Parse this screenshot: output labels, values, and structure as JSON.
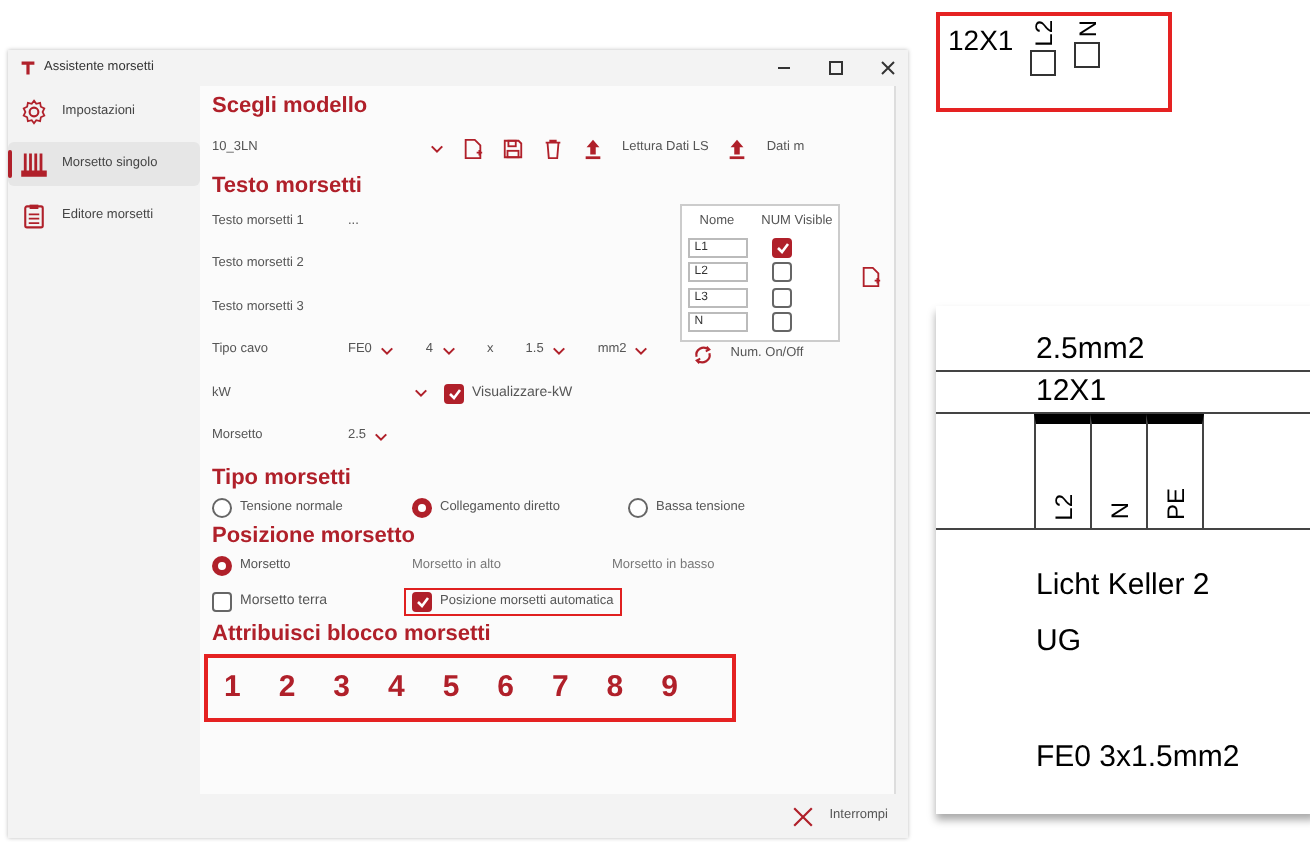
{
  "window": {
    "title": "Assistente morsetti"
  },
  "sidebar": {
    "items": [
      {
        "label": "Impostazioni",
        "selected": false,
        "kind": "gear"
      },
      {
        "label": "Morsetto singolo",
        "selected": true,
        "kind": "terminal"
      },
      {
        "label": "Editore morsetti",
        "selected": false,
        "kind": "clipboard"
      }
    ]
  },
  "model": {
    "heading": "Scegli modello",
    "value": "10_3LN",
    "actions": [
      {
        "kind": "new"
      },
      {
        "kind": "save"
      },
      {
        "kind": "delete"
      },
      {
        "kind": "upload",
        "label": "Lettura Dati LS"
      },
      {
        "kind": "upload",
        "label": "Dati m"
      }
    ]
  },
  "text_section": {
    "heading": "Testo morsetti",
    "fields": [
      {
        "label": "Testo morsetti 1",
        "value": "..."
      },
      {
        "label": "Testo morsetti 2"
      },
      {
        "label": "Testo morsetti 3"
      }
    ],
    "cable": {
      "label": "Tipo cavo",
      "selects": [
        "FE0",
        "4",
        "1.5",
        "mm2"
      ],
      "separator": "x"
    },
    "kw": {
      "label": "kW",
      "checkbox": {
        "label": "Visualizzare-kW",
        "checked": true
      }
    },
    "terminal": {
      "label": "Morsetto",
      "value": "2.5"
    },
    "names_table": {
      "columns": [
        "Nome",
        "NUM Visible"
      ],
      "rows": [
        {
          "name": "L1",
          "checked": true
        },
        {
          "name": "L2",
          "checked": false
        },
        {
          "name": "L3",
          "checked": false
        },
        {
          "name": "N",
          "checked": false
        }
      ]
    },
    "num_toggle": "Num. On/Off"
  },
  "type_section": {
    "heading": "Tipo morsetti",
    "options": [
      {
        "label": "Tensione normale",
        "selected": false
      },
      {
        "label": "Collegamento diretto",
        "selected": true
      },
      {
        "label": "Bassa tensione",
        "selected": false
      }
    ]
  },
  "position_section": {
    "heading": "Posizione morsetto",
    "options": [
      {
        "label": "Morsetto",
        "selected": true,
        "disabled": false
      },
      {
        "label": "Morsetto in alto",
        "disabled": true
      },
      {
        "label": "Morsetto in basso",
        "disabled": true
      }
    ],
    "checkboxes": [
      {
        "label": "Morsetto terra",
        "checked": false,
        "highlighted": false
      },
      {
        "label": "Posizione morsetti automatica",
        "checked": true,
        "highlighted": true
      }
    ]
  },
  "block_section": {
    "heading": "Attribuisci blocco morsetti",
    "numbers": [
      "1",
      "2",
      "3",
      "4",
      "5",
      "6",
      "7",
      "8",
      "9"
    ]
  },
  "footer": {
    "cancel": "Interrompi"
  },
  "preview": {
    "label_box": {
      "title": "12X1",
      "terminals": [
        "L2",
        "N"
      ]
    },
    "drawing": {
      "cross_section": "2.5mm2",
      "strip": "12X1",
      "terminals": [
        "L2",
        "N",
        "PE"
      ],
      "lines": [
        "Licht Keller 2",
        "UG"
      ],
      "cable": "FE0 3x1.5mm2"
    }
  }
}
